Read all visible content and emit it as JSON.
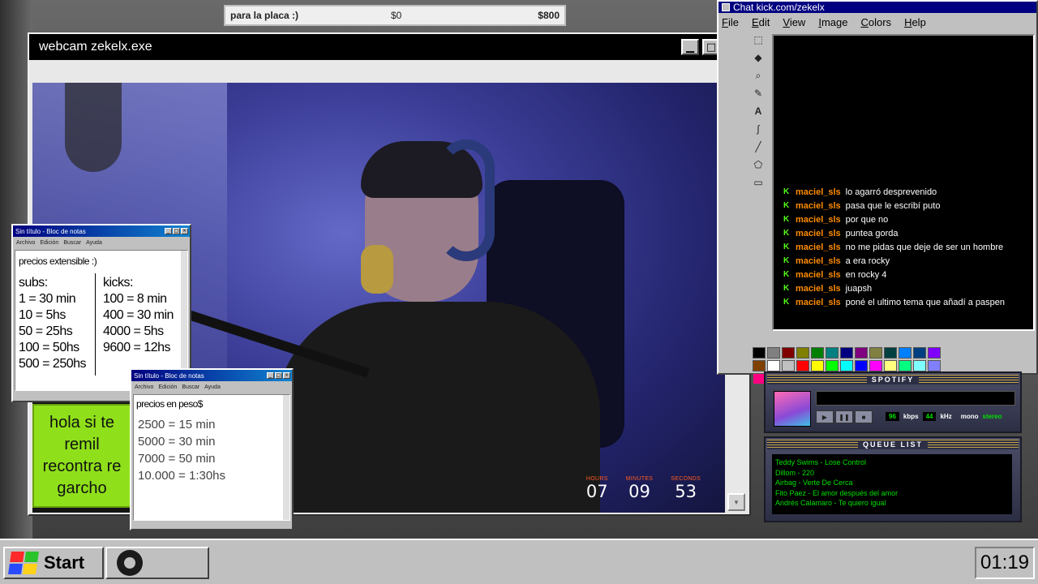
{
  "goal_bar": {
    "label": "para la placa :)",
    "current": "$0",
    "target": "$800"
  },
  "webcam_window": {
    "title": "webcam zekelx.exe",
    "timer": {
      "hours_label": "HOURS",
      "hours": "07",
      "minutes_label": "MINUTES",
      "minutes": "09",
      "seconds_label": "SECONDS",
      "seconds": "53"
    }
  },
  "notepad_subs": {
    "title": "Sin título - Bloc de notas",
    "menu": [
      "Archivo",
      "Edición",
      "Buscar",
      "Ayuda"
    ],
    "heading": "precios extensible :)",
    "subs": [
      "subs:",
      "1 = 30 min",
      "10 = 5hs",
      "50 = 25hs",
      "100 = 50hs",
      "500 = 250hs"
    ],
    "kicks": [
      "kicks:",
      "100 = 8 min",
      "400 = 30 min",
      "4000 = 5hs",
      "9600 = 12hs"
    ]
  },
  "notepad_pesos": {
    "title": "Sin título - Bloc de notas",
    "menu": [
      "Archivo",
      "Edición",
      "Buscar",
      "Ayuda"
    ],
    "heading": "precios en peso$",
    "rows": [
      "2500 = 15 min",
      "5000 = 30 min",
      "7000 = 50 min",
      "10.000 = 1:30hs"
    ]
  },
  "green_note": {
    "text": "hola si te remil recontra re garcho"
  },
  "chat_window": {
    "title": "Chat kick.com/zekelx",
    "menu": [
      "File",
      "Edit",
      "View",
      "Image",
      "Colors",
      "Help"
    ],
    "messages": [
      {
        "user": "maciel_sls",
        "text": "lo agarró desprevenido"
      },
      {
        "user": "maciel_sls",
        "text": "pasa que le escribí puto"
      },
      {
        "user": "maciel_sls",
        "text": "por que no"
      },
      {
        "user": "maciel_sls",
        "text": "puntea gorda"
      },
      {
        "user": "maciel_sls",
        "text": "no me pidas que deje de ser un hombre"
      },
      {
        "user": "maciel_sls",
        "text": "a era rocky"
      },
      {
        "user": "maciel_sls",
        "text": "en rocky 4"
      },
      {
        "user": "maciel_sls",
        "text": "juapsh"
      },
      {
        "user": "maciel_sls",
        "text": "poné el ultimo tema que añadí a paspen"
      }
    ],
    "palette": [
      "#000000",
      "#808080",
      "#800000",
      "#808000",
      "#008000",
      "#008080",
      "#000080",
      "#800080",
      "#808040",
      "#004040",
      "#0080ff",
      "#004080",
      "#8000ff",
      "#804000",
      "#ffffff",
      "#c0c0c0",
      "#ff0000",
      "#ffff00",
      "#00ff00",
      "#00ffff",
      "#0000ff",
      "#ff00ff",
      "#ffff80",
      "#00ff80",
      "#80ffff",
      "#8080ff",
      "#ff0080",
      "#ff8040"
    ]
  },
  "spotify": {
    "title": "SPOTIFY",
    "kbps": "96",
    "kbps_label": "kbps",
    "khz": "44",
    "khz_label": "kHz",
    "mono": "mono",
    "stereo": "stereo"
  },
  "queue": {
    "title": "QUEUE LIST",
    "items": [
      "Teddy Swims - Lose Control",
      "Dillom - 220",
      "Airbag - Verte De Cerca",
      "Fito Paez - El amor después del amor",
      "Andrés Calamaro - Te quiero igual"
    ]
  },
  "taskbar": {
    "start_label": "Start",
    "clock": "01:19"
  }
}
